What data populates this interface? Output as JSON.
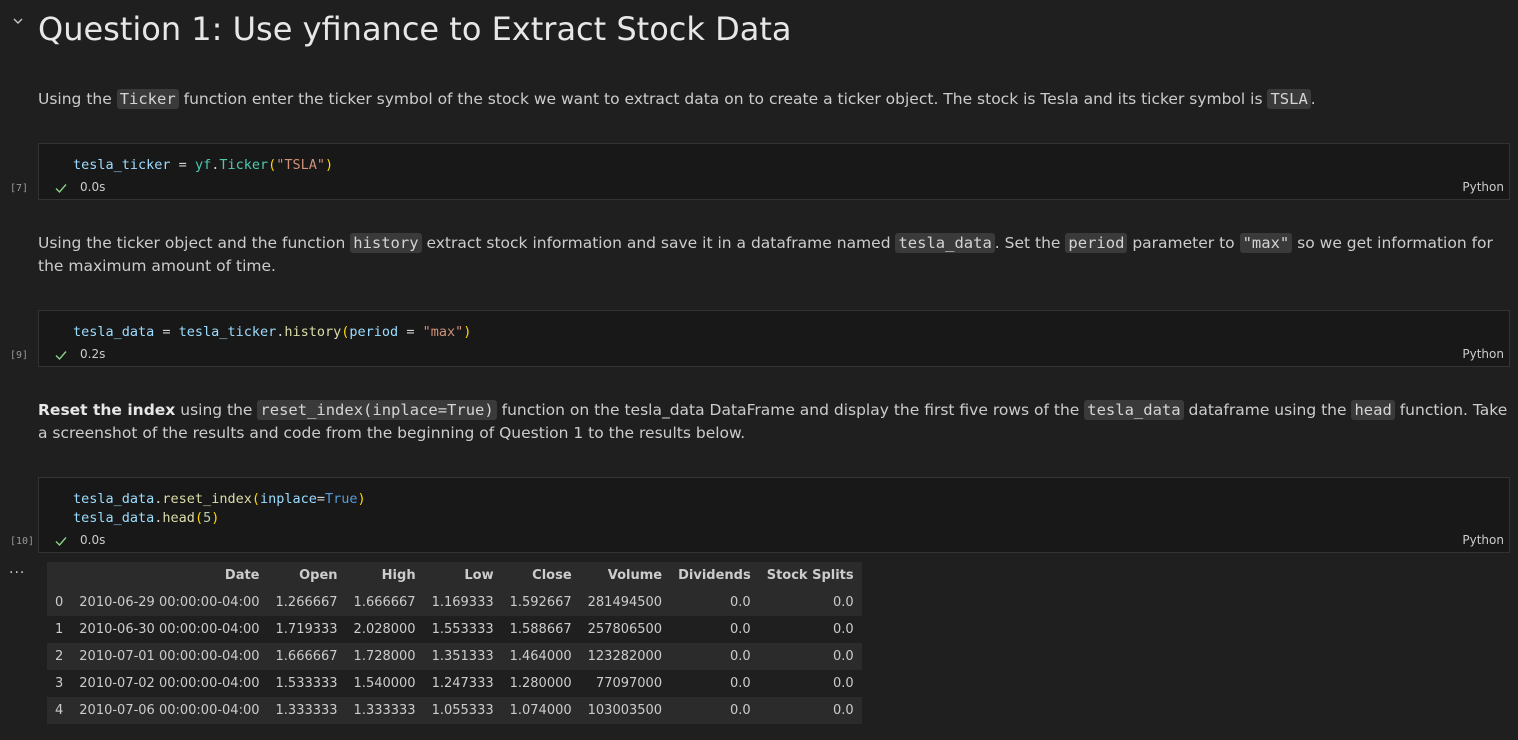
{
  "heading": "Question 1: Use yfinance to Extract Stock Data",
  "md1": {
    "t1": "Using the ",
    "c1": "Ticker",
    "t2": " function enter the ticker symbol of the stock we want to extract data on to create a ticker object. The stock is Tesla and its ticker symbol is ",
    "c2": "TSLA",
    "t3": "."
  },
  "cell1": {
    "code": {
      "a": "tesla_ticker",
      "b": " = ",
      "c": "yf",
      "d": ".",
      "e": "Ticker",
      "f": "(",
      "g": "\"TSLA\"",
      "h": ")"
    },
    "exec_count": "[7]",
    "time": "0.0s",
    "language": "Python"
  },
  "md2": {
    "t1": "Using the ticker object and the function ",
    "c1": "history",
    "t2": " extract stock information and save it in a dataframe named ",
    "c2": "tesla_data",
    "t3": ". Set the ",
    "c3": "period",
    "t4": " parameter to ",
    "c4": "\"max\"",
    "t5": " so we get information for the maximum amount of time."
  },
  "cell2": {
    "code": {
      "a": "tesla_data",
      "b": " = ",
      "c": "tesla_ticker",
      "d": ".",
      "e": "history",
      "f": "(",
      "g": "period",
      "h": " = ",
      "i": "\"max\"",
      "j": ")"
    },
    "exec_count": "[9]",
    "time": "0.2s",
    "language": "Python"
  },
  "md3": {
    "b1": "Reset the index",
    "t1": " using the ",
    "c1": "reset_index(inplace=True)",
    "t2": " function on the tesla_data DataFrame and display the first five rows of the ",
    "c2": "tesla_data",
    "t3": " dataframe using the ",
    "c3": "head",
    "t4": " function. Take a screenshot of the results and code from the beginning of Question 1 to the results below."
  },
  "cell3": {
    "line1": {
      "a": "tesla_data",
      "b": ".",
      "c": "reset_index",
      "d": "(",
      "e": "inplace",
      "f": "=",
      "g": "True",
      "h": ")"
    },
    "line2": {
      "a": "tesla_data",
      "b": ".",
      "c": "head",
      "d": "(",
      "e": "5",
      "f": ")"
    },
    "exec_count": "[10]",
    "time": "0.0s",
    "language": "Python"
  },
  "output": {
    "more_label": "...",
    "headers": [
      "",
      "Date",
      "Open",
      "High",
      "Low",
      "Close",
      "Volume",
      "Dividends",
      "Stock Splits"
    ],
    "rows": [
      [
        "0",
        "2010-06-29 00:00:00-04:00",
        "1.266667",
        "1.666667",
        "1.169333",
        "1.592667",
        "281494500",
        "0.0",
        "0.0"
      ],
      [
        "1",
        "2010-06-30 00:00:00-04:00",
        "1.719333",
        "2.028000",
        "1.553333",
        "1.588667",
        "257806500",
        "0.0",
        "0.0"
      ],
      [
        "2",
        "2010-07-01 00:00:00-04:00",
        "1.666667",
        "1.728000",
        "1.351333",
        "1.464000",
        "123282000",
        "0.0",
        "0.0"
      ],
      [
        "3",
        "2010-07-02 00:00:00-04:00",
        "1.533333",
        "1.540000",
        "1.247333",
        "1.280000",
        "77097000",
        "0.0",
        "0.0"
      ],
      [
        "4",
        "2010-07-06 00:00:00-04:00",
        "1.333333",
        "1.333333",
        "1.055333",
        "1.074000",
        "103003500",
        "0.0",
        "0.0"
      ]
    ]
  },
  "icons": {
    "collapse": "chevron-down-icon",
    "check": "check-icon"
  },
  "colors": {
    "background": "#1f1f1f",
    "cell_background": "#181818",
    "success_check": "#89d185",
    "inline_code_bg": "#3a3a3a"
  }
}
